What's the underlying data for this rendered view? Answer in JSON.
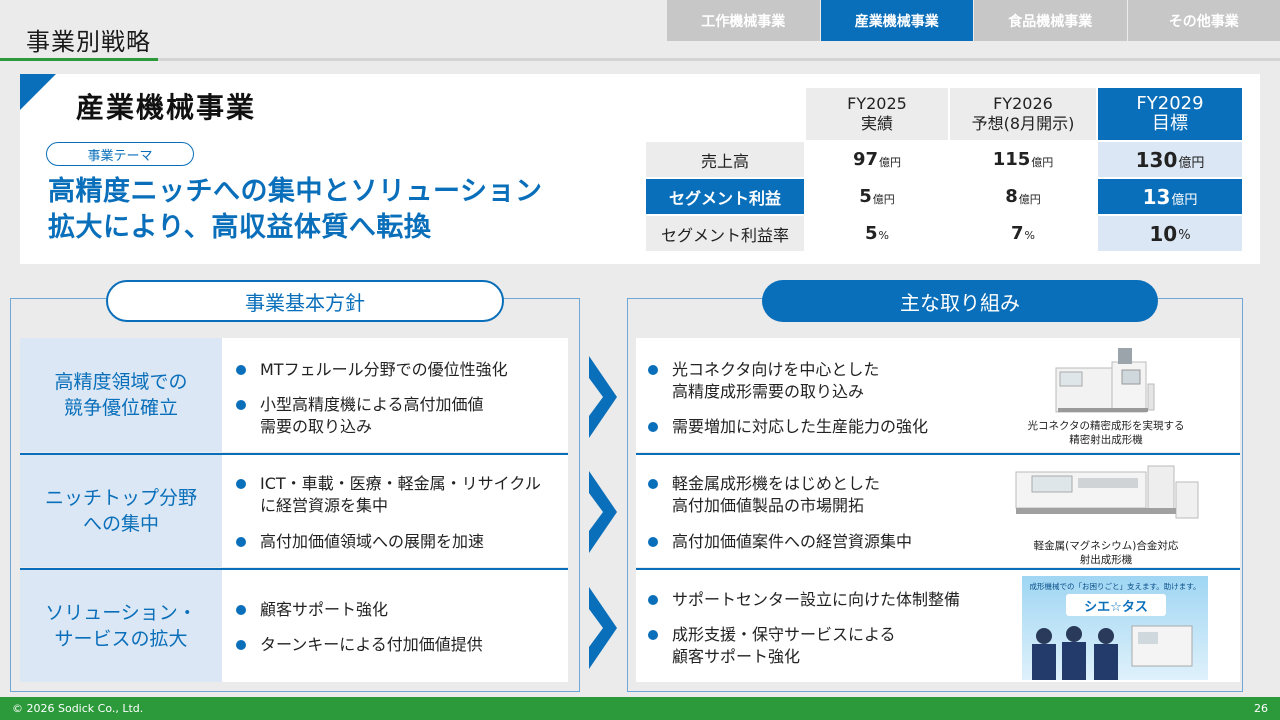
{
  "header": {
    "title": "事業別戦略",
    "tabs": [
      "工作機械事業",
      "産業機械事業",
      "食品機械事業",
      "その他事業"
    ],
    "active_tab": 1
  },
  "card": {
    "title": "産業機械事業",
    "theme_label": "事業テーマ",
    "theme_line1": "高精度ニッチへの集中とソリューション",
    "theme_line2": "拡大により、高収益体質へ転換"
  },
  "kpi": {
    "headers": [
      {
        "line1": "FY2025",
        "line2": "実績"
      },
      {
        "line1": "FY2026",
        "line2": "予想(8月開示)"
      },
      {
        "line1": "FY2029",
        "line2": "目標"
      }
    ],
    "rows": [
      {
        "label": "売上高",
        "values": [
          "97",
          "115",
          "130"
        ],
        "unit": "億円"
      },
      {
        "label": "セグメント利益",
        "values": [
          "5",
          "8",
          "13"
        ],
        "unit": "億円"
      },
      {
        "label": "セグメント利益率",
        "values": [
          "5",
          "7",
          "10"
        ],
        "unit": "%"
      }
    ]
  },
  "policy": {
    "heading": "事業基本方針",
    "rows": [
      {
        "label_line1": "高精度領域での",
        "label_line2": "競争優位確立",
        "bullets": [
          {
            "l1": "MTフェルール分野での優位性強化",
            "l2": ""
          },
          {
            "l1": "小型高精度機による高付加価値",
            "l2": "需要の取り込み"
          }
        ]
      },
      {
        "label_line1": "ニッチトップ分野",
        "label_line2": "への集中",
        "bullets": [
          {
            "l1": "ICT・車載・医療・軽金属・リサイクル",
            "l2": "に経営資源を集中"
          },
          {
            "l1": "高付加価値領域への展開を加速",
            "l2": ""
          }
        ]
      },
      {
        "label_line1": "ソリューション・",
        "label_line2": "サービスの拡大",
        "bullets": [
          {
            "l1": "顧客サポート強化",
            "l2": ""
          },
          {
            "l1": "ターンキーによる付加価値提供",
            "l2": ""
          }
        ]
      }
    ]
  },
  "initiatives": {
    "heading": "主な取り組み",
    "rows": [
      {
        "bullets": [
          {
            "l1": "光コネクタ向けを中心とした",
            "l2": "高精度成形需要の取り込み"
          },
          {
            "l1": "需要増加に対応した生産能力の強化",
            "l2": ""
          }
        ],
        "caption_line1": "光コネクタの精密成形を実現する",
        "caption_line2": "精密射出成形機"
      },
      {
        "bullets": [
          {
            "l1": "軽金属成形機をはじめとした",
            "l2": "高付加価値製品の市場開拓"
          },
          {
            "l1": "高付加価値案件への経営資源集中",
            "l2": ""
          }
        ],
        "caption_line1": "軽金属(マグネシウム)合金対応",
        "caption_line2": "射出成形機"
      },
      {
        "bullets": [
          {
            "l1": "サポートセンター設立に向けた体制整備",
            "l2": ""
          },
          {
            "l1": "成形支援・保守サービスによる",
            "l2": "顧客サポート強化"
          }
        ],
        "banner_text": "成形機械での「お困りごと」支えます。助けます。",
        "banner_logo": "シエ☆タス"
      }
    ]
  },
  "footer": {
    "copyright": "© 2026 Sodick Co., Ltd.",
    "page": "26"
  },
  "colors": {
    "brand_blue": "#0a6fba",
    "light_blue": "#dbe7f4",
    "green": "#2c9a3a"
  }
}
